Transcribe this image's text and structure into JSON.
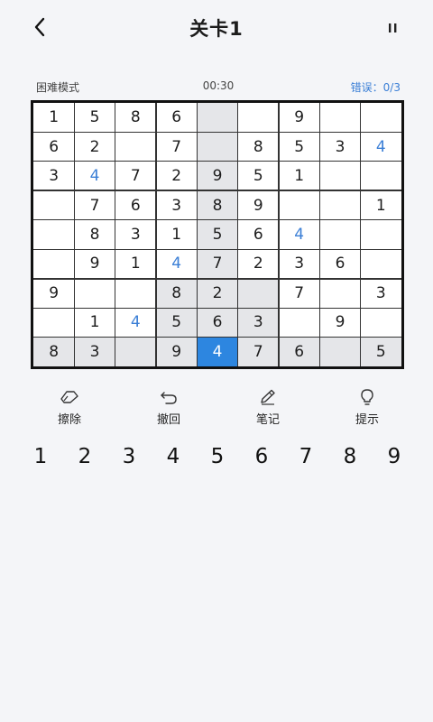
{
  "header": {
    "title": "关卡1"
  },
  "status": {
    "mode": "困难模式",
    "timer": "00:30",
    "errors": "错误：0/3"
  },
  "board": {
    "cells": [
      [
        "1",
        "5",
        "8",
        "6",
        "",
        "",
        "9",
        "",
        ""
      ],
      [
        "6",
        "2",
        "",
        "7",
        "",
        "8",
        "5",
        "3",
        "4"
      ],
      [
        "3",
        "4",
        "7",
        "2",
        "9",
        "5",
        "1",
        "",
        ""
      ],
      [
        "",
        "7",
        "6",
        "3",
        "8",
        "9",
        "",
        "",
        "1"
      ],
      [
        "",
        "8",
        "3",
        "1",
        "5",
        "6",
        "4",
        "",
        ""
      ],
      [
        "",
        "9",
        "1",
        "4",
        "7",
        "2",
        "3",
        "6",
        ""
      ],
      [
        "9",
        "",
        "",
        "8",
        "2",
        "",
        "7",
        "",
        "3"
      ],
      [
        "",
        "1",
        "4",
        "5",
        "6",
        "3",
        "",
        "9",
        ""
      ],
      [
        "8",
        "3",
        "",
        "9",
        "4",
        "7",
        "6",
        "",
        "5"
      ]
    ],
    "user_entries": [
      [
        1,
        8
      ],
      [
        2,
        1
      ],
      [
        4,
        6
      ],
      [
        5,
        3
      ],
      [
        7,
        2
      ],
      [
        8,
        4
      ]
    ],
    "selected": [
      8,
      4
    ],
    "colors": {
      "selected": "#2d86e0",
      "highlight": "#e5e6e9",
      "user_digit": "#3b7fd6"
    }
  },
  "tools": [
    {
      "label": "擦除",
      "icon": "eraser-icon"
    },
    {
      "label": "撤回",
      "icon": "undo-icon"
    },
    {
      "label": "笔记",
      "icon": "pencil-icon"
    },
    {
      "label": "提示",
      "icon": "lightbulb-icon"
    }
  ],
  "numpad": [
    "1",
    "2",
    "3",
    "4",
    "5",
    "6",
    "7",
    "8",
    "9"
  ]
}
